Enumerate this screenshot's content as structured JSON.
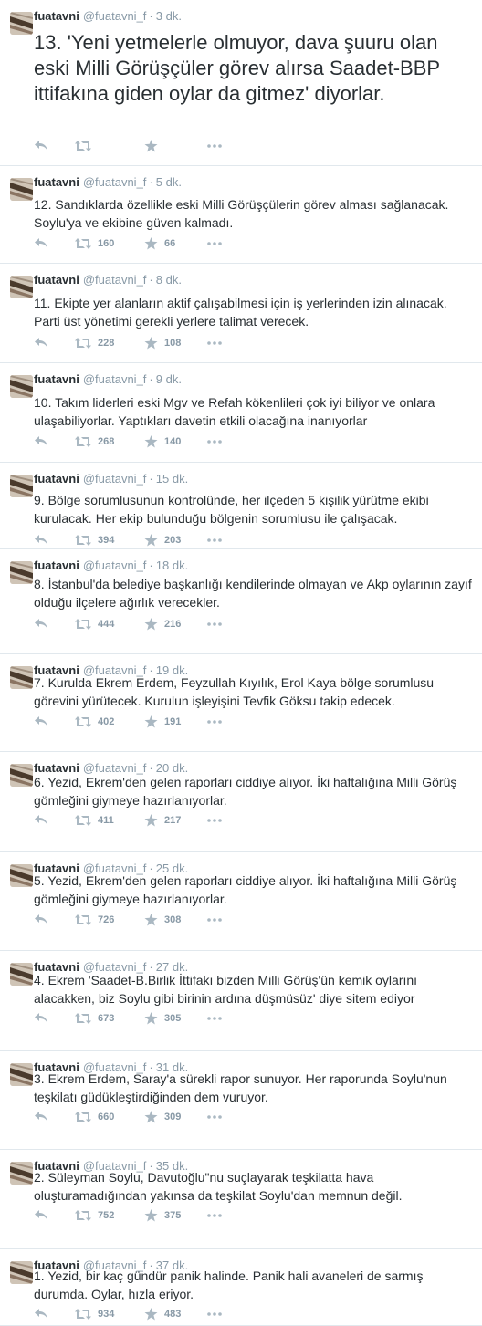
{
  "tweets": [
    {
      "name": "fuatavni",
      "handle": "@fuatavni_f",
      "time": "3 dk.",
      "text": "13. 'Yeni yetmelerle olmuyor, dava şuuru olan eski Milli Görüşçüler görev alırsa Saadet-BBP ittifakına giden oylar da gitmez' diyorlar.",
      "retweets": "",
      "favorites": ""
    },
    {
      "name": "fuatavni",
      "handle": "@fuatavni_f",
      "time": "5 dk.",
      "text": "12. Sandıklarda özellikle eski Milli Görüşçülerin görev alması sağlanacak. Soylu'ya ve ekibine güven kalmadı.",
      "retweets": "160",
      "favorites": "66"
    },
    {
      "name": "fuatavni",
      "handle": "@fuatavni_f",
      "time": "8 dk.",
      "text": "11. Ekipte yer alanların aktif çalışabilmesi için iş yerlerinden izin alınacak. Parti üst yönetimi gerekli yerlere talimat verecek.",
      "retweets": "228",
      "favorites": "108"
    },
    {
      "name": "fuatavni",
      "handle": "@fuatavni_f",
      "time": "9 dk.",
      "text": "10. Takım liderleri eski Mgv ve Refah kökenlileri çok iyi biliyor ve onlara ulaşabiliyorlar. Yaptıkları davetin etkili olacağına inanıyorlar",
      "retweets": "268",
      "favorites": "140"
    },
    {
      "name": "fuatavni",
      "handle": "@fuatavni_f",
      "time": "15 dk.",
      "text": "9. Bölge sorumlusunun kontrolünde, her ilçeden 5 kişilik yürütme ekibi kurulacak. Her ekip bulunduğu bölgenin sorumlusu ile çalışacak.",
      "retweets": "394",
      "favorites": "203"
    },
    {
      "name": "fuatavni",
      "handle": "@fuatavni_f",
      "time": "18 dk.",
      "text": "8. İstanbul'da belediye başkanlığı kendilerinde olmayan ve Akp oylarının zayıf olduğu ilçelere ağırlık verecekler.",
      "retweets": "444",
      "favorites": "216"
    },
    {
      "name": "fuatavni",
      "handle": "@fuatavni_f",
      "time": "19 dk.",
      "text": "7. Kurulda Ekrem Erdem, Feyzullah Kıyılık, Erol Kaya bölge sorumlusu görevini yürütecek. Kurulun işleyişini Tevfik Göksu takip edecek.",
      "retweets": "402",
      "favorites": "191"
    },
    {
      "name": "fuatavni",
      "handle": "@fuatavni_f",
      "time": "20 dk.",
      "text": "6. Yezid, Ekrem'den gelen raporları ciddiye alıyor. İki haftalığına Milli Görüş gömleğini giymeye hazırlanıyorlar.",
      "retweets": "411",
      "favorites": "217"
    },
    {
      "name": "fuatavni",
      "handle": "@fuatavni_f",
      "time": "25 dk.",
      "text": "5. Yezid, Ekrem'den gelen raporları ciddiye alıyor. İki haftalığına Milli Görüş gömleğini giymeye hazırlanıyorlar.",
      "retweets": "726",
      "favorites": "308"
    },
    {
      "name": "fuatavni",
      "handle": "@fuatavni_f",
      "time": "27 dk.",
      "text": "4. Ekrem 'Saadet-B.Birlik İttifakı bizden Milli Görüş'ün kemik oylarını alacakken, biz Soylu gibi birinin ardına düşmüsüz' diye sitem ediyor",
      "retweets": "673",
      "favorites": "305"
    },
    {
      "name": "fuatavni",
      "handle": "@fuatavni_f",
      "time": "31 dk.",
      "text": "3. Ekrem Erdem, Saray'a sürekli rapor sunuyor. Her raporunda Soylu'nun teşkilatı güdükleştirdiğinden dem vuruyor.",
      "retweets": "660",
      "favorites": "309"
    },
    {
      "name": "fuatavni",
      "handle": "@fuatavni_f",
      "time": "35 dk.",
      "text": "2. Süleyman Soylu, Davutoğlu\"nu suçlayarak teşkilatta hava oluşturamadığından yakınsa da teşkilat Soylu'dan memnun değil.",
      "retweets": "752",
      "favorites": "375"
    },
    {
      "name": "fuatavni",
      "handle": "@fuatavni_f",
      "time": "37 dk.",
      "text": "1. Yezid, bir kaç gündür panik halinde. Panik hali avaneleri de sarmış durumda. Oylar, hızla eriyor.",
      "retweets": "934",
      "favorites": "483"
    }
  ],
  "separator": "·",
  "colors": {
    "text": "#292f33",
    "meta": "#8899a6",
    "icon": "#aab8c2",
    "border": "#e1e8ed"
  },
  "icons": {
    "reply": "reply-icon",
    "retweet": "retweet-icon",
    "favorite": "star-icon",
    "more": "more-icon"
  }
}
